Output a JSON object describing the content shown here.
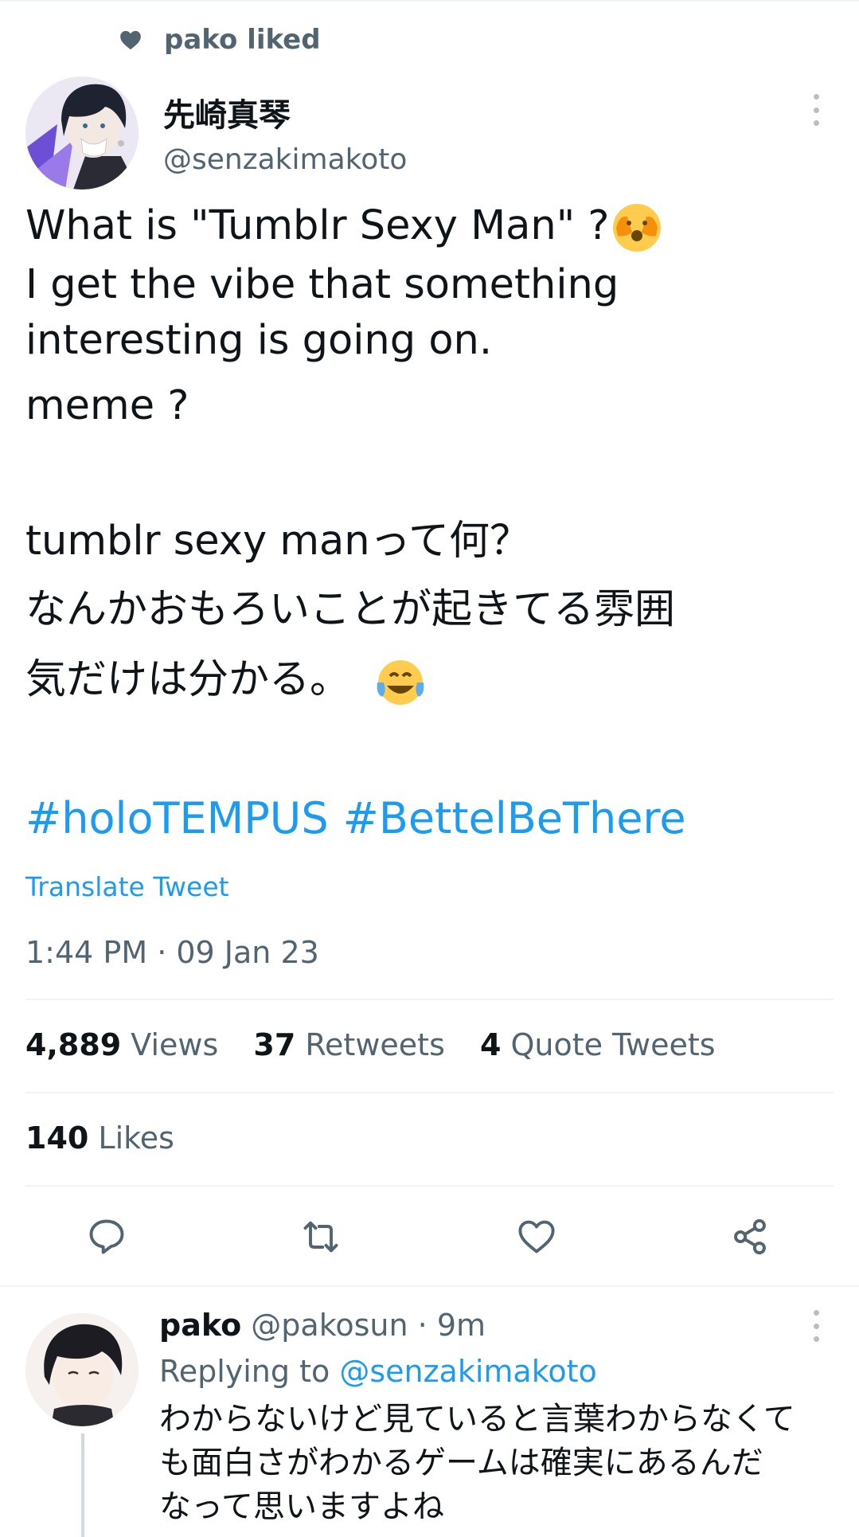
{
  "liked_banner": {
    "icon": "heart-icon",
    "text": "pako liked"
  },
  "tweet": {
    "author_name": "先崎真琴",
    "author_handle": "@senzakimakoto",
    "body_lines": [
      "What is \"Tumblr Sexy Man\" ?",
      "I get the vibe that something",
      "interesting is going on.",
      "meme ?",
      "tumblr sexy manって何？",
      "なんかおもろいことが起きてる雰囲",
      "気だけは分かる。"
    ],
    "emojis": [
      "face-peeking-emoji",
      "tears-of-joy-emoji"
    ],
    "hashtags": [
      "#holoTEMPUS",
      "#BettelBeThere"
    ],
    "translate_label": "Translate Tweet",
    "timestamp": "1:44 PM · 09 Jan 23",
    "stats": {
      "views_count": "4,889",
      "views_label": "Views",
      "retweets_count": "37",
      "retweets_label": "Retweets",
      "quotes_count": "4",
      "quotes_label": "Quote Tweets"
    },
    "likes": {
      "count": "140",
      "label": "Likes"
    },
    "actions": [
      "reply-icon",
      "retweet-icon",
      "like-icon",
      "share-icon"
    ]
  },
  "reply": {
    "author_name": "pako",
    "author_handle": "@pakosun",
    "time": "· 9m",
    "replying_label": "Replying to",
    "replying_handle": "@senzakimakoto",
    "text_lines": [
      "わからないけど見ていると言葉わからなくて",
      "も面白さがわかるゲームは確実にあるんだ",
      "なって思いますよね"
    ]
  },
  "colors": {
    "accent": "#1d9bf0",
    "secondary_text": "#536471",
    "primary_text": "#0f1419",
    "divider": "#eff3f4"
  }
}
